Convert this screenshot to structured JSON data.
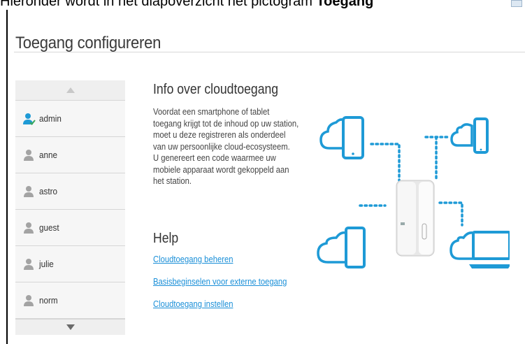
{
  "top_strip": {
    "text_prefix": "Hieronder wordt in het diapoverzicht het pictogram ",
    "text_bold": "Toegang"
  },
  "dialog": {
    "title": "Toegang configureren"
  },
  "users": [
    {
      "name": "admin",
      "is_admin": true
    },
    {
      "name": "anne",
      "is_admin": false
    },
    {
      "name": "astro",
      "is_admin": false
    },
    {
      "name": "guest",
      "is_admin": false
    },
    {
      "name": "julie",
      "is_admin": false
    },
    {
      "name": "norm",
      "is_admin": false
    }
  ],
  "info": {
    "title": "Info over cloudtoegang",
    "lines": [
      "Voordat een smartphone of tablet",
      "toegang krijgt tot de inhoud op uw station,",
      "moet u deze registreren als onderdeel",
      "van uw persoonlijke cloud-ecosysteem.",
      "U genereert een code waarmee uw",
      "mobiele apparaat wordt gekoppeld aan",
      "het station."
    ]
  },
  "help": {
    "title": "Help",
    "links": [
      "Cloudtoegang beheren",
      "Basisbeginselen voor externe toegang",
      "Cloudtoegang instellen"
    ]
  },
  "colors": {
    "accent": "#1a8fd8",
    "illustration_blue": "#1e9ad6",
    "row_bg": "#f6f6f6",
    "icon_grey": "#a3a3a3",
    "admin_check": "#3aa85a"
  }
}
